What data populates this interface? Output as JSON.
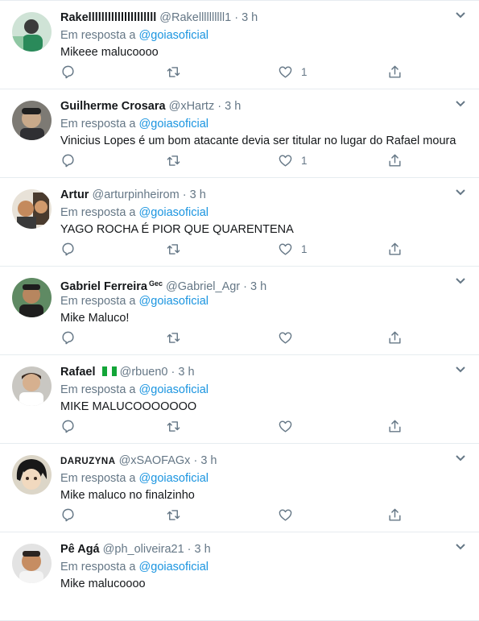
{
  "colors": {
    "link": "#1b95e0",
    "muted": "#657786",
    "border": "#e6ecf0"
  },
  "icons": {
    "reply": "reply-icon",
    "retweet": "retweet-icon",
    "like": "heart-icon",
    "share": "share-icon",
    "more": "chevron-down-icon"
  },
  "tweets": [
    {
      "name": "Rakelllllllllllllllllllll",
      "handle": "@Rakellllllllll1",
      "dot": "·",
      "time": "3 h",
      "reply_prefix": "Em resposta a",
      "reply_to": "@goiasoficial",
      "text": "Mikeee malucoooo",
      "likes": "1"
    },
    {
      "name": "Guilherme Crosara",
      "handle": "@xHartz",
      "dot": "·",
      "time": "3 h",
      "reply_prefix": "Em resposta a",
      "reply_to": "@goiasoficial",
      "text": "Vinicius Lopes é um bom atacante devia ser titular no lugar do Rafael moura",
      "likes": "1"
    },
    {
      "name": "Artur",
      "handle": "@arturpinheirom",
      "dot": "·",
      "time": "3 h",
      "reply_prefix": "Em resposta a",
      "reply_to": "@goiasoficial",
      "text": "YAGO ROCHA É PIOR QUE QUARENTENA",
      "likes": "1"
    },
    {
      "name": "Gabriel Ferreira",
      "name_suffix": "Gec",
      "handle": "@Gabriel_Agr",
      "dot": "·",
      "time": "3 h",
      "reply_prefix": "Em resposta a",
      "reply_to": "@goiasoficial",
      "text": "Mike Maluco!",
      "likes": ""
    },
    {
      "name": "Rafael",
      "handle": "@rbuen0",
      "dot": "·",
      "time": "3 h",
      "reply_prefix": "Em resposta a",
      "reply_to": "@goiasoficial",
      "text": "MIKE MALUCOOOOOOO",
      "likes": ""
    },
    {
      "name": "DARUZYNA",
      "handle": "@xSAOFAGx",
      "dot": "·",
      "time": "3 h",
      "reply_prefix": "Em resposta a",
      "reply_to": "@goiasoficial",
      "text": "Mike maluco no finalzinho",
      "likes": ""
    },
    {
      "name": "Pê Agá",
      "handle": "@ph_oliveira21",
      "dot": "·",
      "time": "3 h",
      "reply_prefix": "Em resposta a",
      "reply_to": "@goiasoficial",
      "text": "Mike malucoooo",
      "likes": ""
    }
  ]
}
